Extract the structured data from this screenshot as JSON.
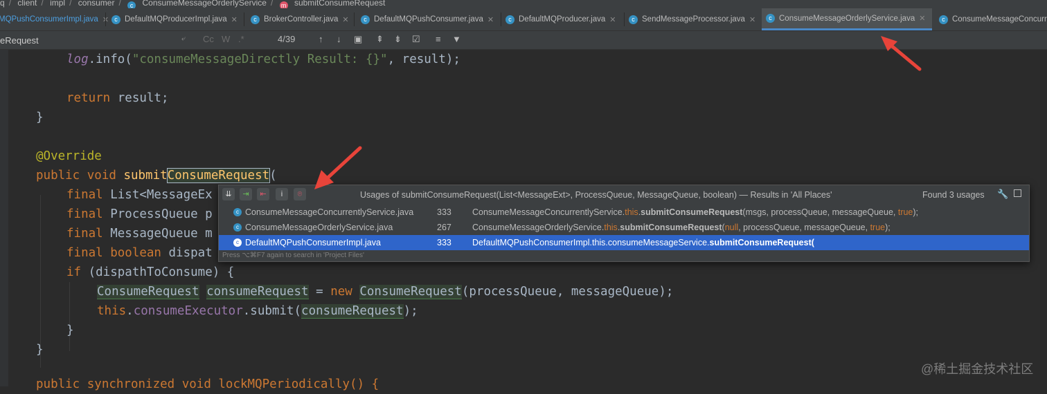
{
  "breadcrumb": [
    "q",
    "client",
    "impl",
    "consumer",
    "ConsumeMessageOrderlyService",
    "submitConsumeRequest"
  ],
  "tabs": [
    "MQPushConsumerImpl.java",
    "DefaultMQProducerImpl.java",
    "BrokerController.java",
    "DefaultMQPushConsumer.java",
    "DefaultMQProducer.java",
    "SendMessageProcessor.java",
    "ConsumeMessageOrderlyService.java",
    "ConsumeMessageConcurr"
  ],
  "search": {
    "value": "eRequest",
    "result_count": "4/39",
    "opts": [
      "Cc",
      "W",
      ".*"
    ]
  },
  "code": {
    "l1_a": "log",
    "l1_b": ".info(",
    "l1_c": "\"consumeMessageDirectly Result: {}\"",
    "l1_d": ", result);",
    "l2_a": "return",
    "l2_b": " result;",
    "l3": "}",
    "l4": "@Override",
    "l5_a": "public void ",
    "l5_b": "submit",
    "l5_c": "ConsumeRequest",
    "l5_d": "(",
    "l6_a": "final ",
    "l6_b": "List<MessageEx",
    "l7_a": "final ",
    "l7_b": "ProcessQueue p",
    "l8_a": "final ",
    "l8_b": "MessageQueue m",
    "l9_a": "final boolean ",
    "l9_b": "dispat",
    "l10_a": "if",
    "l10_b": " (dispathToConsume) {",
    "l11_a": "ConsumeRequest",
    "l11_b": "consumeRequest",
    "l11_c": " = ",
    "l11_d": "new ",
    "l11_e": "ConsumeRequest",
    "l11_f": "(processQueue, messageQueue);",
    "l12_a": "this",
    "l12_b": ".",
    "l12_c": "consumeExecutor",
    "l12_d": ".submit(",
    "l12_e": "consumeRequest",
    "l12_f": ");",
    "l13": "}",
    "l14": "}",
    "l15": "public synchronized void lockMQPeriodically() {"
  },
  "usages_popup": {
    "title": "Usages of submitConsumeRequest(List<MessageExt>, ProcessQueue, MessageQueue, boolean) — Results in 'All Places'",
    "count": "Found 3 usages",
    "rows": [
      {
        "file": "ConsumeMessageConcurrentlyService.java",
        "line": "333",
        "s1": "ConsumeMessageConcurrentlyService.",
        "s2": "this",
        "s3": ".",
        "s4": "submitConsumeRequest",
        "s5": "(msgs, processQueue, messageQueue, ",
        "s6": "true",
        "s7": ");"
      },
      {
        "file": "ConsumeMessageOrderlyService.java",
        "line": "267",
        "s1": "ConsumeMessageOrderlyService.",
        "s2": "this",
        "s3": ".",
        "s4": "submitConsumeRequest",
        "s5": "(",
        "s6": "null",
        "s7": ", processQueue, messageQueue, ",
        "s8": "true",
        "s9": ");"
      },
      {
        "file": "DefaultMQPushConsumerImpl.java",
        "line": "333",
        "s1": "DefaultMQPushConsumerImpl.this.consumeMessageService.",
        "s4": "submitConsumeRequest",
        "s5": "("
      }
    ],
    "footer": "Press ⌥⌘F7 again to search in 'Project Files'"
  },
  "watermark": "@稀土掘金技术社区",
  "colors": {
    "accent": "#2f65ca",
    "arrow": "#e8443a",
    "background": "#2b2b2b"
  }
}
